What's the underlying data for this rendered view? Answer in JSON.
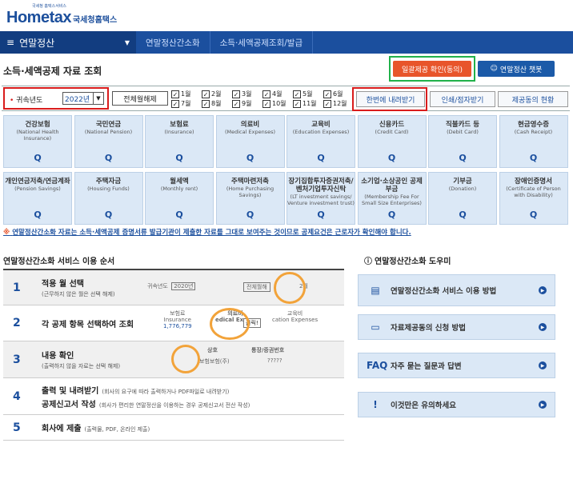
{
  "logo": {
    "brand": "Hometax",
    "kor": "국세청홈택스",
    "tiny": "국세청 홈택스서비스"
  },
  "nav": {
    "menu": "연말정산",
    "crumbs": [
      "연말정산간소화",
      "소득·세액공제조회/발급"
    ]
  },
  "page_title": "소득·세액공제 자료 조회",
  "buttons": {
    "consent": "일괄제공 확인(동의)",
    "chatbot": "연말정산 챗봇",
    "clear_all": "전체월해제",
    "download": "한번에 내려받기",
    "print": "인쇄/점자받기",
    "status": "제공동의 현황"
  },
  "filter": {
    "year_label": "귀속년도",
    "year_value": "2022년",
    "months": [
      "1월",
      "2월",
      "3월",
      "4월",
      "5월",
      "6월",
      "7월",
      "8월",
      "9월",
      "10월",
      "11월",
      "12월"
    ]
  },
  "tiles": [
    {
      "k": "건강보험",
      "e": "(National Health Insurance)"
    },
    {
      "k": "국민연금",
      "e": "(National Pension)"
    },
    {
      "k": "보험료",
      "e": "(Insurance)"
    },
    {
      "k": "의료비",
      "e": "(Medical Expenses)"
    },
    {
      "k": "교육비",
      "e": "(Education Expenses)"
    },
    {
      "k": "신용카드",
      "e": "(Credit Card)"
    },
    {
      "k": "직불카드 등",
      "e": "(Debit Card)"
    },
    {
      "k": "현금영수증",
      "e": "(Cash Receipt)"
    },
    {
      "k": "개인연금저축/연금계좌",
      "e": "(Pension Savings)"
    },
    {
      "k": "주택자금",
      "e": "(Housing Funds)"
    },
    {
      "k": "월세액",
      "e": "(Monthly rent)"
    },
    {
      "k": "주택마련저축",
      "e": "(Home Purchasing Savings)"
    },
    {
      "k": "장기집합투자증권저축/벤처기업투자신탁",
      "e": "(LT investment savings/ Venture investment trust)"
    },
    {
      "k": "소기업·소상공인 공제부금",
      "e": "(Membership Fee For Small Size Enterprises)"
    },
    {
      "k": "기부금",
      "e": "(Donation)"
    },
    {
      "k": "장애인증명서",
      "e": "(Certificate of Person with Disability)"
    }
  ],
  "notice": {
    "prefix": "※",
    "text": "연말정산간소화 자료는 소득·세액공제 증명서류 발급기관이 제출한 자료를 그대로 보여주는 것이므로 공제요건은 근로자가 확인해야 합니다."
  },
  "steps_title": "연말정산간소화 서비스 이용 순서",
  "steps": [
    {
      "n": "1",
      "t": "적용 월 선택",
      "s": "(근무하지 않은 월은 선택 해제)"
    },
    {
      "n": "2",
      "t": "각 공제 항목 선택하여 조회",
      "s": ""
    },
    {
      "n": "3",
      "t": "내용 확인",
      "s": "(출력하지 않을 자료는 선택 해제)"
    },
    {
      "n": "4",
      "t": "출력 및 내려받기",
      "si": "(회사의 요구에 따라 출력하거나 PDF파일로 내려받기)",
      "t2": "공제신고서 작성",
      "si2": "(회사가 편리한 연말정산을 이용하는 경우 공제신고서 전산 작성)"
    },
    {
      "n": "5",
      "t": "회사에 제출",
      "si": "(출력물, PDF, 온라인 제출)"
    }
  ],
  "mini": {
    "year": "귀속년도",
    "year_val": "2020년",
    "all": "전체월해",
    "ins": "보험료",
    "ins_e": "Insurance",
    "amt": "1,776,779",
    "med": "의료비",
    "med_e": "edical Expen",
    "click": "클릭!",
    "edu": "교육비",
    "edu_e": "cation Expenses",
    "col1": "상호",
    "col2": "통장/증권번호",
    "row1": "보험보험(주)",
    "row1v": "?????",
    "mon": "2월"
  },
  "help_title": "연말정산간소화 도우미",
  "help": [
    {
      "ic": "book-icon",
      "label": "연말정산간소화 서비스 이용 방법"
    },
    {
      "ic": "document-icon",
      "label": "자료제공동의 신청 방법"
    },
    {
      "ic": "FAQ",
      "label": "자주 묻는 질문과 답변"
    },
    {
      "ic": "warning-icon",
      "label": "이것만은 유의하세요"
    }
  ]
}
